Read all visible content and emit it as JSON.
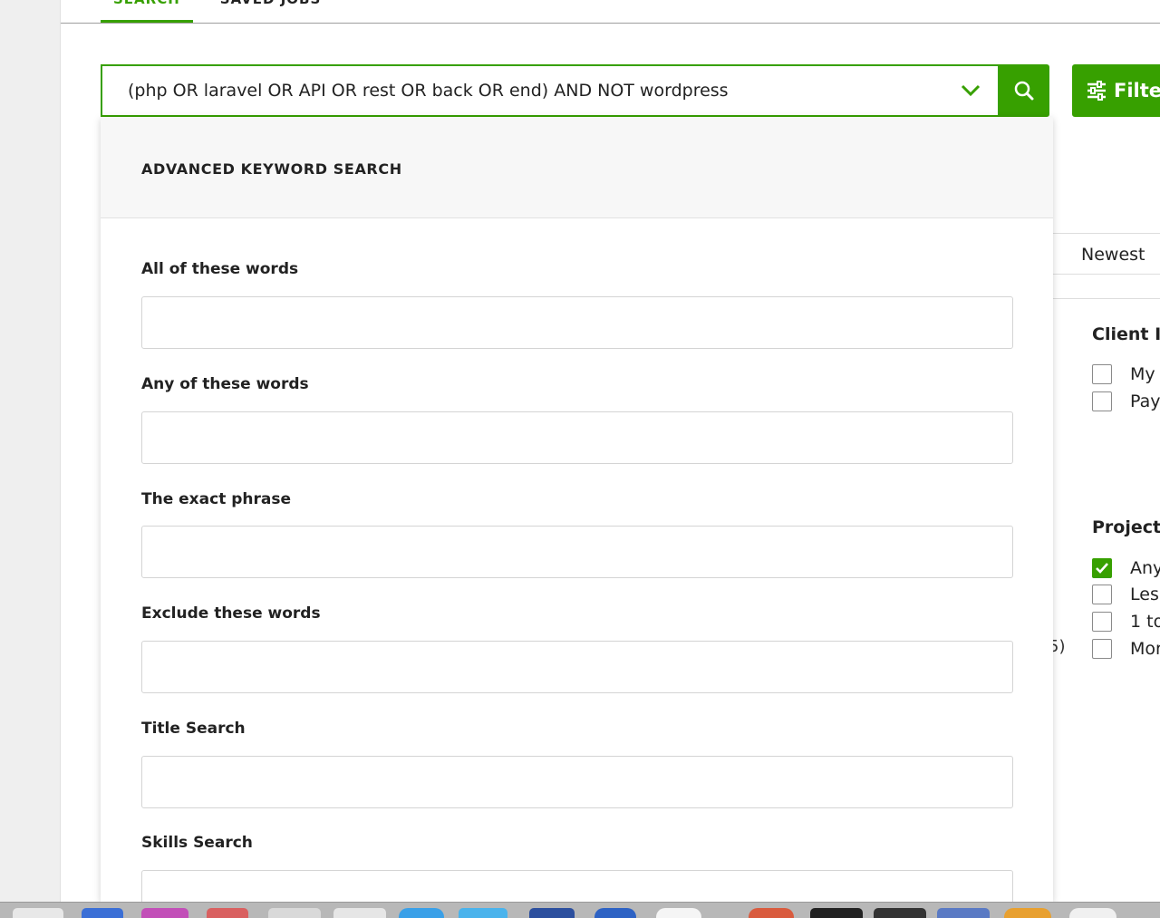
{
  "tabs": [
    {
      "label": "SEARCH",
      "active": true
    },
    {
      "label": "SAVED JOBS",
      "active": false
    }
  ],
  "search": {
    "query": "(php OR laravel OR API OR rest OR back OR end) AND NOT wordpress"
  },
  "filters_button": {
    "label": "Filter"
  },
  "sort": {
    "value": "Newest"
  },
  "client_info": {
    "heading": "Client I",
    "options": [
      {
        "label": "My",
        "checked": false
      },
      {
        "label": "Pay",
        "checked": false
      }
    ]
  },
  "project_length": {
    "heading": "Project",
    "options": [
      {
        "label": "Any",
        "checked": true
      },
      {
        "label": "Les",
        "checked": false
      },
      {
        "label": "1 to",
        "checked": false
      },
      {
        "label": "Mor",
        "checked": false
      }
    ],
    "left_fragment": "5)"
  },
  "advanced": {
    "title": "ADVANCED KEYWORD SEARCH",
    "fields": [
      {
        "label": "All of these words",
        "value": ""
      },
      {
        "label": "Any of these words",
        "value": ""
      },
      {
        "label": "The exact phrase",
        "value": ""
      },
      {
        "label": "Exclude these words",
        "value": ""
      },
      {
        "label": "Title Search",
        "value": ""
      },
      {
        "label": "Skills Search",
        "value": ""
      }
    ]
  },
  "colors": {
    "accent": "#37a000"
  }
}
